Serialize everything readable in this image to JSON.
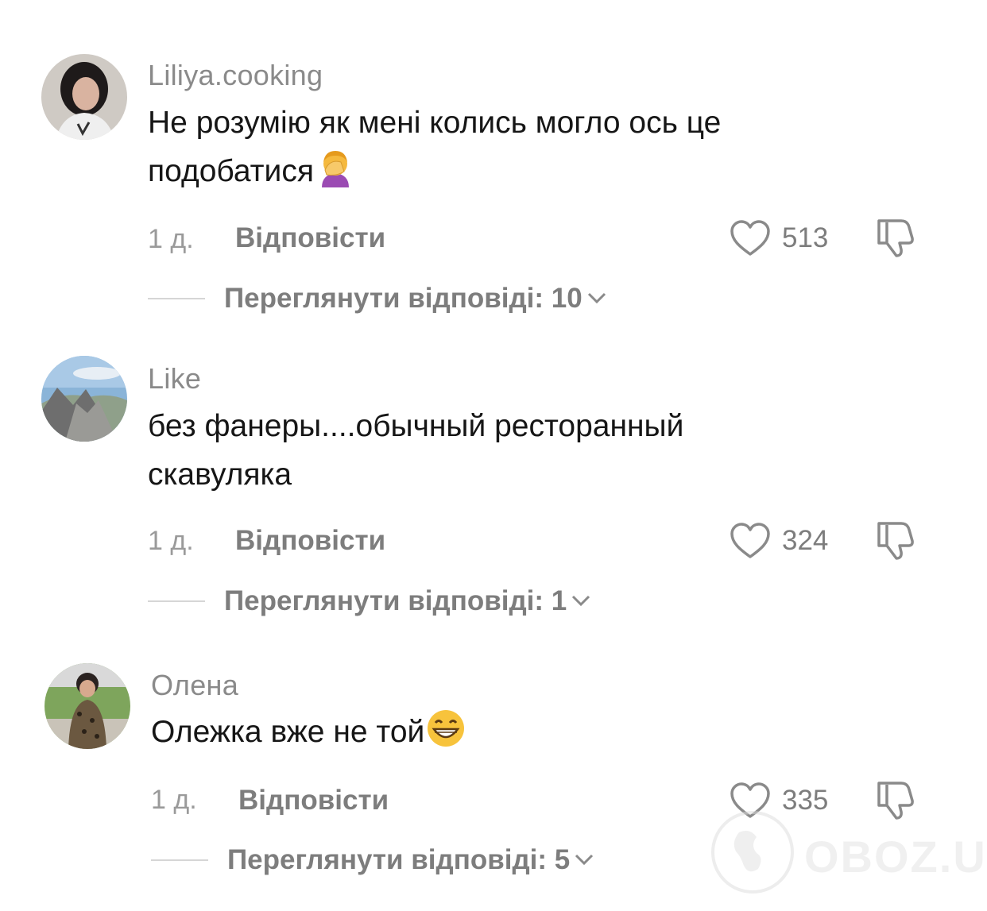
{
  "comments": [
    {
      "username": "Liliya.cooking",
      "text_line1": "Не розумію як мені колись могло ось це",
      "text_line2": "подобатися",
      "emoji": "face-palm-emoji",
      "time": "1 д.",
      "reply_label": "Відповісти",
      "likes": "513",
      "view_replies": "Переглянути відповіді: 10"
    },
    {
      "username": "Like",
      "text_line1": "без фанеры....обычный ресторанный",
      "text_line2": "скавуляка",
      "time": "1 д.",
      "reply_label": "Відповісти",
      "likes": "324",
      "view_replies": "Переглянути відповіді: 1"
    },
    {
      "username": "Олена",
      "text_line1": "Олежка вже не той",
      "emoji": "grinning-face-emoji",
      "time": "1 д.",
      "reply_label": "Відповісти",
      "likes": "335",
      "view_replies": "Переглянути відповіді: 5"
    }
  ],
  "watermark": {
    "text": "OBOZ.UA"
  },
  "colors": {
    "username": "#8a8a8a",
    "text": "#161616",
    "muted": "#7d7d7d"
  },
  "icons": {
    "like": "heart-outline-icon",
    "dislike": "thumbs-down-icon",
    "expand": "chevron-down-icon"
  }
}
